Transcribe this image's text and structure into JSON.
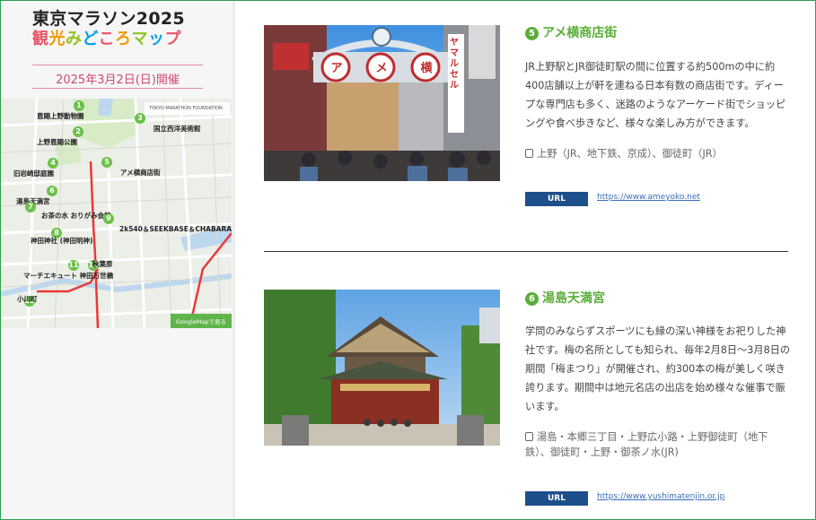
{
  "sidebar": {
    "title_line1": "東京マラソン2025",
    "title_line2_chars": [
      "観",
      "光",
      "み",
      "ど",
      "こ",
      "ろ",
      "マ",
      "ッ",
      "プ"
    ],
    "title_line2_colors": [
      "#e9546b",
      "#f39800",
      "#8fc31f",
      "#00a0e9",
      "#e9546b",
      "#f39800",
      "#8fc31f",
      "#00a0e9",
      "#e9546b"
    ],
    "date": "2025年3月2日(日)開催",
    "map": {
      "header_small": "TOKYO MARATHON FOUNDATION",
      "labels": [
        {
          "num": "1",
          "text": "恩賜上野動物園"
        },
        {
          "num": "2",
          "text": "上野恩賜公園"
        },
        {
          "num": "3",
          "text": "国立西洋美術館"
        },
        {
          "num": "4",
          "text": "旧岩崎邸庭園"
        },
        {
          "num": "5",
          "text": "アメ横商店街"
        },
        {
          "num": "6",
          "text": "湯島天満宮"
        },
        {
          "num": "7",
          "text": "お茶の水 おりがみ会館"
        },
        {
          "num": "8",
          "text": "神田神社 (神田明神)"
        },
        {
          "num": "9",
          "text": "2k540＆SEEKBASE＆CHABARA"
        },
        {
          "num": "10",
          "text": "秋葉原"
        },
        {
          "num": "11",
          "text": "マーチエキュート 神田万世橋"
        },
        {
          "num": "12",
          "text": "小川町"
        }
      ],
      "gmap_button": "GoogleMapで見る"
    }
  },
  "entries": [
    {
      "num": "5",
      "title": "アメ横商店街",
      "description": "JR上野駅とJR御徒町駅の間に位置する約500mの中に約400店舗以上が軒を連ねる日本有数の商店街です。ディープな専門店も多く、迷路のようなアーケード街でショッピングや食べ歩きなど、様々な楽しみ方ができます。",
      "access": "上野（JR、地下鉄、京成）、御徒町（JR）",
      "url_label": "URL",
      "url": "https://www.ameyoko.net"
    },
    {
      "num": "6",
      "title": "湯島天満宮",
      "description": "学問のみならずスポーツにも縁の深い神様をお祀りした神社です。梅の名所としても知られ、毎年2月8日〜3月8日の期間「梅まつり」が開催され、約300本の梅が美しく咲き誇ります。期間中は地元名店の出店を始め様々な催事で賑います。",
      "access": "湯島・本郷三丁目・上野広小路・上野御徒町（地下鉄）、御徒町・上野・御茶ノ水(JR)",
      "url_label": "URL",
      "url": "https://www.yushimatenjin.or.jp"
    }
  ],
  "photo1_sign": [
    "ア",
    "メ",
    "横"
  ],
  "photo1_side_sign": "ヤマルセル",
  "colors": {
    "accent_green": "#5aae3a",
    "url_blue": "#1d4f8a",
    "date_pink": "#d04a74"
  }
}
